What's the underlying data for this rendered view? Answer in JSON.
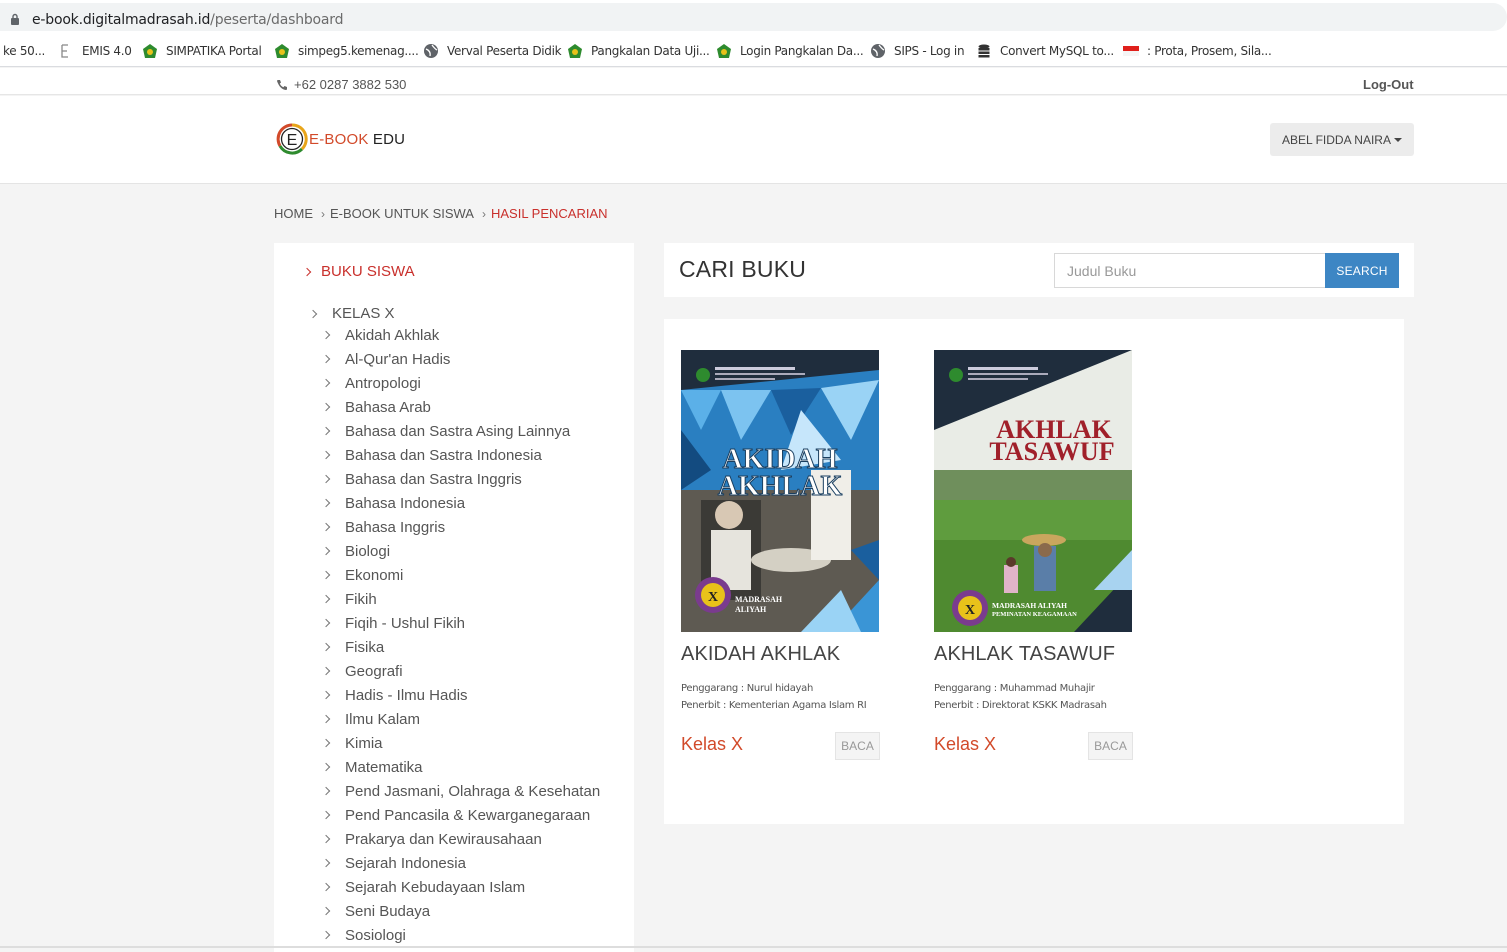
{
  "browser": {
    "url_host": "e-book.digitalmadrasah.id",
    "url_path": "/peserta/dashboard"
  },
  "bookmarks": [
    {
      "label": "ke 50...",
      "icon": "none"
    },
    {
      "label": "EMIS 4.0",
      "icon": "emis-icon"
    },
    {
      "label": "SIMPATIKA Portal",
      "icon": "kemenag-icon"
    },
    {
      "label": "simpeg5.kemenag....",
      "icon": "kemenag-icon"
    },
    {
      "label": "Verval Peserta Didik",
      "icon": "globe-icon"
    },
    {
      "label": "Pangkalan Data Uji...",
      "icon": "kemenag-icon"
    },
    {
      "label": "Login Pangkalan Da...",
      "icon": "kemenag-icon"
    },
    {
      "label": "SIPS - Log in",
      "icon": "globe-icon"
    },
    {
      "label": "Convert MySQL to...",
      "icon": "database-icon"
    },
    {
      "label": ": Prota, Prosem, Sila...",
      "icon": "flag-icon"
    }
  ],
  "topbar": {
    "phone": "+62 0287 3882 530",
    "logout": "Log-Out"
  },
  "header": {
    "logo_part1": "E-BOOK",
    "logo_part2": " EDU",
    "logo_letter": "E",
    "user_name": "ABEL FIDDA NAIRA"
  },
  "breadcrumb": {
    "home": "HOME",
    "level2": "E-BOOK UNTUK SISWA",
    "current": "HASIL PENCARIAN"
  },
  "sidebar": {
    "heading": "BUKU SISWA",
    "kelas": "KELAS X",
    "subjects": [
      "Akidah Akhlak",
      "Al-Qur'an Hadis",
      "Antropologi",
      "Bahasa Arab",
      "Bahasa dan Sastra Asing Lainnya",
      "Bahasa dan Sastra Indonesia",
      "Bahasa dan Sastra Inggris",
      "Bahasa Indonesia",
      "Bahasa Inggris",
      "Biologi",
      "Ekonomi",
      "Fikih",
      "Fiqih - Ushul Fikih",
      "Fisika",
      "Geografi",
      "Hadis - Ilmu Hadis",
      "Ilmu Kalam",
      "Kimia",
      "Matematika",
      "Pend Jasmani, Olahraga & Kesehatan",
      "Pend Pancasila & Kewarganegaraan",
      "Prakarya dan Kewirausahaan",
      "Sejarah Indonesia",
      "Sejarah Kebudayaan Islam",
      "Seni Budaya",
      "Sosiologi"
    ]
  },
  "search": {
    "title": "CARI BUKU",
    "placeholder": "Judul Buku",
    "button": "SEARCH"
  },
  "books": [
    {
      "title": "AKIDAH AKHLAK",
      "cover_title_line1": "AKIDAH",
      "cover_title_line2": "AKHLAK",
      "cover_badge_letter": "X",
      "cover_sub_line1": "MADRASAH",
      "cover_sub_line2": "ALIYAH",
      "penggarang": "Penggarang : Nurul hidayah",
      "penerbit": "Penerbit : Kementerian Agama Islam RI",
      "kelas": "Kelas X",
      "read_label": "BACA"
    },
    {
      "title": "AKHLAK TASAWUF",
      "cover_title_line1": "AKHLAK",
      "cover_title_line2": "TASAWUF",
      "cover_badge_letter": "X",
      "cover_sub_line1": "MADRASAH ALIYAH",
      "cover_sub_line2": "PEMINATAN KEAGAMAAN",
      "penggarang": "Penggarang : Muhammad Muhajir",
      "penerbit": "Penerbit : Direktorat KSKK Madrasah",
      "kelas": "Kelas X",
      "read_label": "BACA"
    }
  ],
  "colors": {
    "accent_red": "#c9302c",
    "search_blue": "#3d86c4",
    "kelas_orange": "#d24a2a"
  }
}
